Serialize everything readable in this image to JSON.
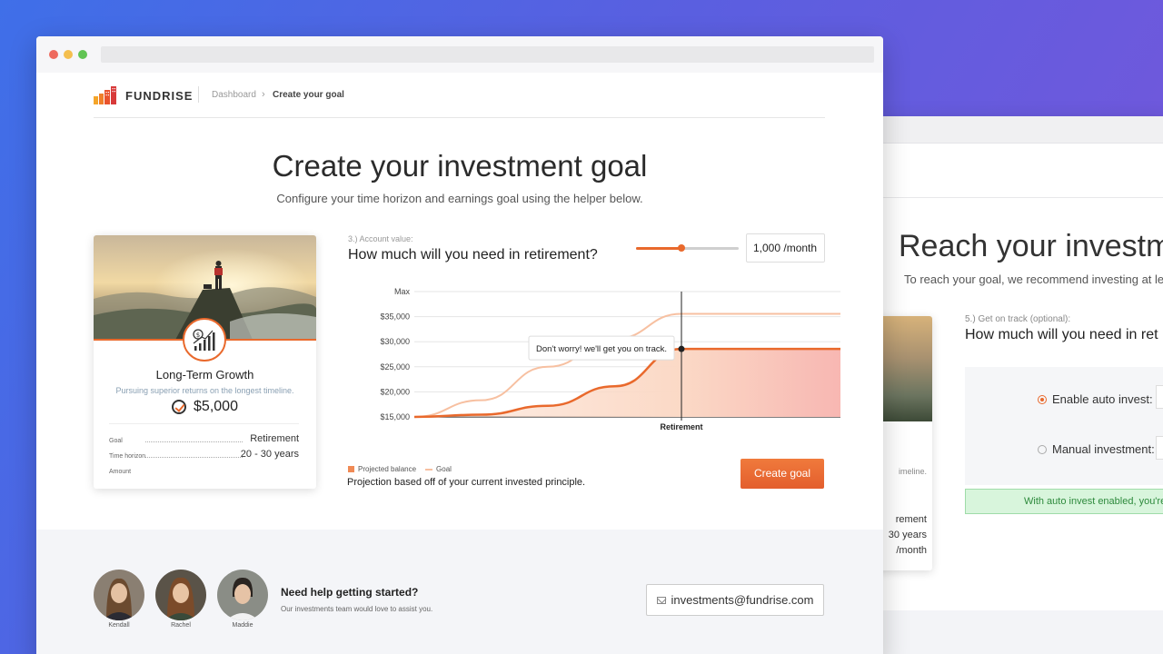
{
  "back_window": {
    "title": "Reach your investme",
    "subtitle": "To reach your goal, we recommend investing at leas",
    "step_label": "5.) Get on track (optional):",
    "question": "How much will you need in ret",
    "card_frag_1": "imeline.",
    "card_frag_2": "rement",
    "card_frag_3": "30 years",
    "card_frag_4": "/month",
    "option_auto": "Enable auto invest:",
    "option_manual": "Manual investment:",
    "alert_text": "With auto invest enabled, you're"
  },
  "header": {
    "brand": "FUNDRISE",
    "breadcrumb_parent": "Dashboard",
    "breadcrumb_sep": "›",
    "breadcrumb_current": "Create your goal"
  },
  "hero": {
    "title": "Create your investment goal",
    "subtitle": "Configure your time horizon and earnings goal using the helper below."
  },
  "goal_card": {
    "title": "Long-Term Growth",
    "subtitle": "Pursuing superior returns on the longest timeline.",
    "amount": "$5,000",
    "rows": [
      {
        "label": "Goal",
        "value": "Retirement"
      },
      {
        "label": "Time horizon",
        "value": "20 - 30 years"
      },
      {
        "label": "Amount",
        "value": ""
      }
    ]
  },
  "calculator": {
    "step_label": "3.) Account value:",
    "question": "How much will you need in retirement?",
    "slider_fraction": 0.44,
    "amount_value": "1,000 /month",
    "legend_projected": "Projected balance",
    "legend_goal": "Goal",
    "projection_note": "Projection based off of your current invested principle.",
    "create_button": "Create goal"
  },
  "chart_data": {
    "type": "area",
    "y_tick_labels": [
      "Max",
      "$35,000",
      "$30,000",
      "$25,000",
      "$20,000",
      "$15,000"
    ],
    "ylim": [
      15000,
      37500
    ],
    "x_marker_label": "Retirement",
    "retirement_fraction": 0.6,
    "tooltip": "Don't worry! we'll get you on track.",
    "series": [
      {
        "name": "Projected balance",
        "x": [
          0,
          0.15,
          0.3,
          0.45,
          0.6,
          1.0
        ],
        "values": [
          15000,
          15400,
          17000,
          20500,
          27200,
          27200
        ]
      },
      {
        "name": "Goal",
        "x": [
          0,
          0.15,
          0.3,
          0.45,
          0.6,
          1.0
        ],
        "values": [
          15000,
          18000,
          24000,
          29000,
          33500,
          33500
        ]
      }
    ],
    "colors": {
      "projected": "#e9692c",
      "goal": "#f7c0a1",
      "fill_start": "#fbd9c6",
      "fill_end": "#f7b3b0"
    }
  },
  "footer": {
    "help_title": "Need help getting started?",
    "help_sub": "Our investments team would love to assist you.",
    "email": "investments@fundrise.com",
    "team": [
      {
        "name": "Kendall"
      },
      {
        "name": "Rachel"
      },
      {
        "name": "Maddie"
      }
    ]
  }
}
